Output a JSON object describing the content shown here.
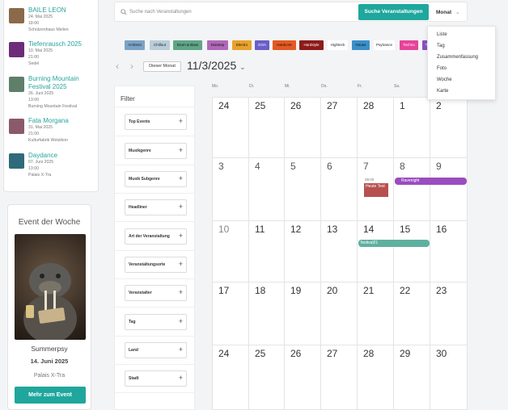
{
  "sidebar": {
    "events": [
      {
        "title": "BAILE LEON",
        "date": "24. Mai 2025",
        "time": "18:00",
        "venue": "Schützenhaus Meilen",
        "color": "#8a6a4a"
      },
      {
        "title": "Tiefenrausch 2025",
        "date": "10. Mai 2025",
        "time": "21:00",
        "venue": "Sedel",
        "color": "#6d2c7a"
      },
      {
        "title": "Burning Mountain Festival 2025",
        "date": "26. Juni 2025",
        "time": "13:00",
        "venue": "Burning Mountain Festival",
        "color": "#5f7f6a"
      },
      {
        "title": "Fata Morgana",
        "date": "31. Mai 2025",
        "time": "21:00",
        "venue": "Kulturfabrik Wetzikon",
        "color": "#8a5a6a"
      },
      {
        "title": "Daydance",
        "date": "07. Juni 2025",
        "time": "13:00",
        "venue": "Palais X-Tra",
        "color": "#2f6b7a"
      }
    ],
    "event_of_week": {
      "heading": "Event der Woche",
      "name": "Summerpsy",
      "date": "14. Juni 2025",
      "venue": "Palais X-Tra",
      "button": "Mehr zum Event",
      "poster_text": "HAPPY NEW YEAR"
    }
  },
  "search": {
    "placeholder": "Suche nach Veranstaltungen",
    "button": "Suche Veranstaltungen",
    "view_label": "Monat"
  },
  "view_menu": [
    "Liste",
    "Tag",
    "Zusammenfassung",
    "Foto",
    "Woche",
    "Karte"
  ],
  "genres": [
    {
      "label": "Ambient",
      "color": "#7aa3c6"
    },
    {
      "label": "Chillout",
      "color": "#b8cdd8"
    },
    {
      "label": "Drum & Bass",
      "color": "#5fa587"
    },
    {
      "label": "Dubstep",
      "color": "#b068b8"
    },
    {
      "label": "Electro",
      "color": "#e9a12b"
    },
    {
      "label": "GOA",
      "color": "#6a5ec9"
    },
    {
      "label": "Hardcore",
      "color": "#e45a22"
    },
    {
      "label": "Hardstyle",
      "color": "#8e1a1a"
    },
    {
      "label": "Highteck",
      "color": "#ffffff"
    },
    {
      "label": "House",
      "color": "#3a8fc9"
    },
    {
      "label": "Psytrance",
      "color": "#ffffff"
    },
    {
      "label": "Techno",
      "color": "#e6439a"
    },
    {
      "label": "T",
      "color": "#8a4fc0"
    }
  ],
  "calendar_nav": {
    "prev": "‹",
    "next": "›",
    "today": "Dieser Monat",
    "title": "11/3/2025"
  },
  "filter": {
    "heading": "Filter",
    "items": [
      "Top Events",
      "Musikgenre",
      "Musik Subgenre",
      "Headliner",
      "Art der Veranstaltung",
      "Veranstaltungsorte",
      "Veranstalter",
      "Tag",
      "Land",
      "Stadt"
    ],
    "plus": "+"
  },
  "calendar": {
    "day_headers": [
      "Mo.",
      "Di.",
      "Mi.",
      "Do.",
      "Fr.",
      "Sa.",
      "So."
    ],
    "weeks": [
      [
        24,
        25,
        26,
        27,
        28,
        1,
        2
      ],
      [
        3,
        4,
        5,
        6,
        7,
        8,
        9
      ],
      [
        10,
        11,
        12,
        13,
        14,
        15,
        16
      ],
      [
        17,
        18,
        19,
        20,
        21,
        22,
        23
      ],
      [
        24,
        25,
        26,
        27,
        28,
        29,
        30
      ]
    ],
    "events": {
      "fr7": {
        "time": "08:00",
        "title": "Heute Test",
        "color": "#b85050"
      },
      "sa8": {
        "title": "Ravenight",
        "color": "#9b4cbf"
      },
      "fr14": {
        "title": "festival21",
        "color": "#5fb0a0"
      }
    }
  }
}
